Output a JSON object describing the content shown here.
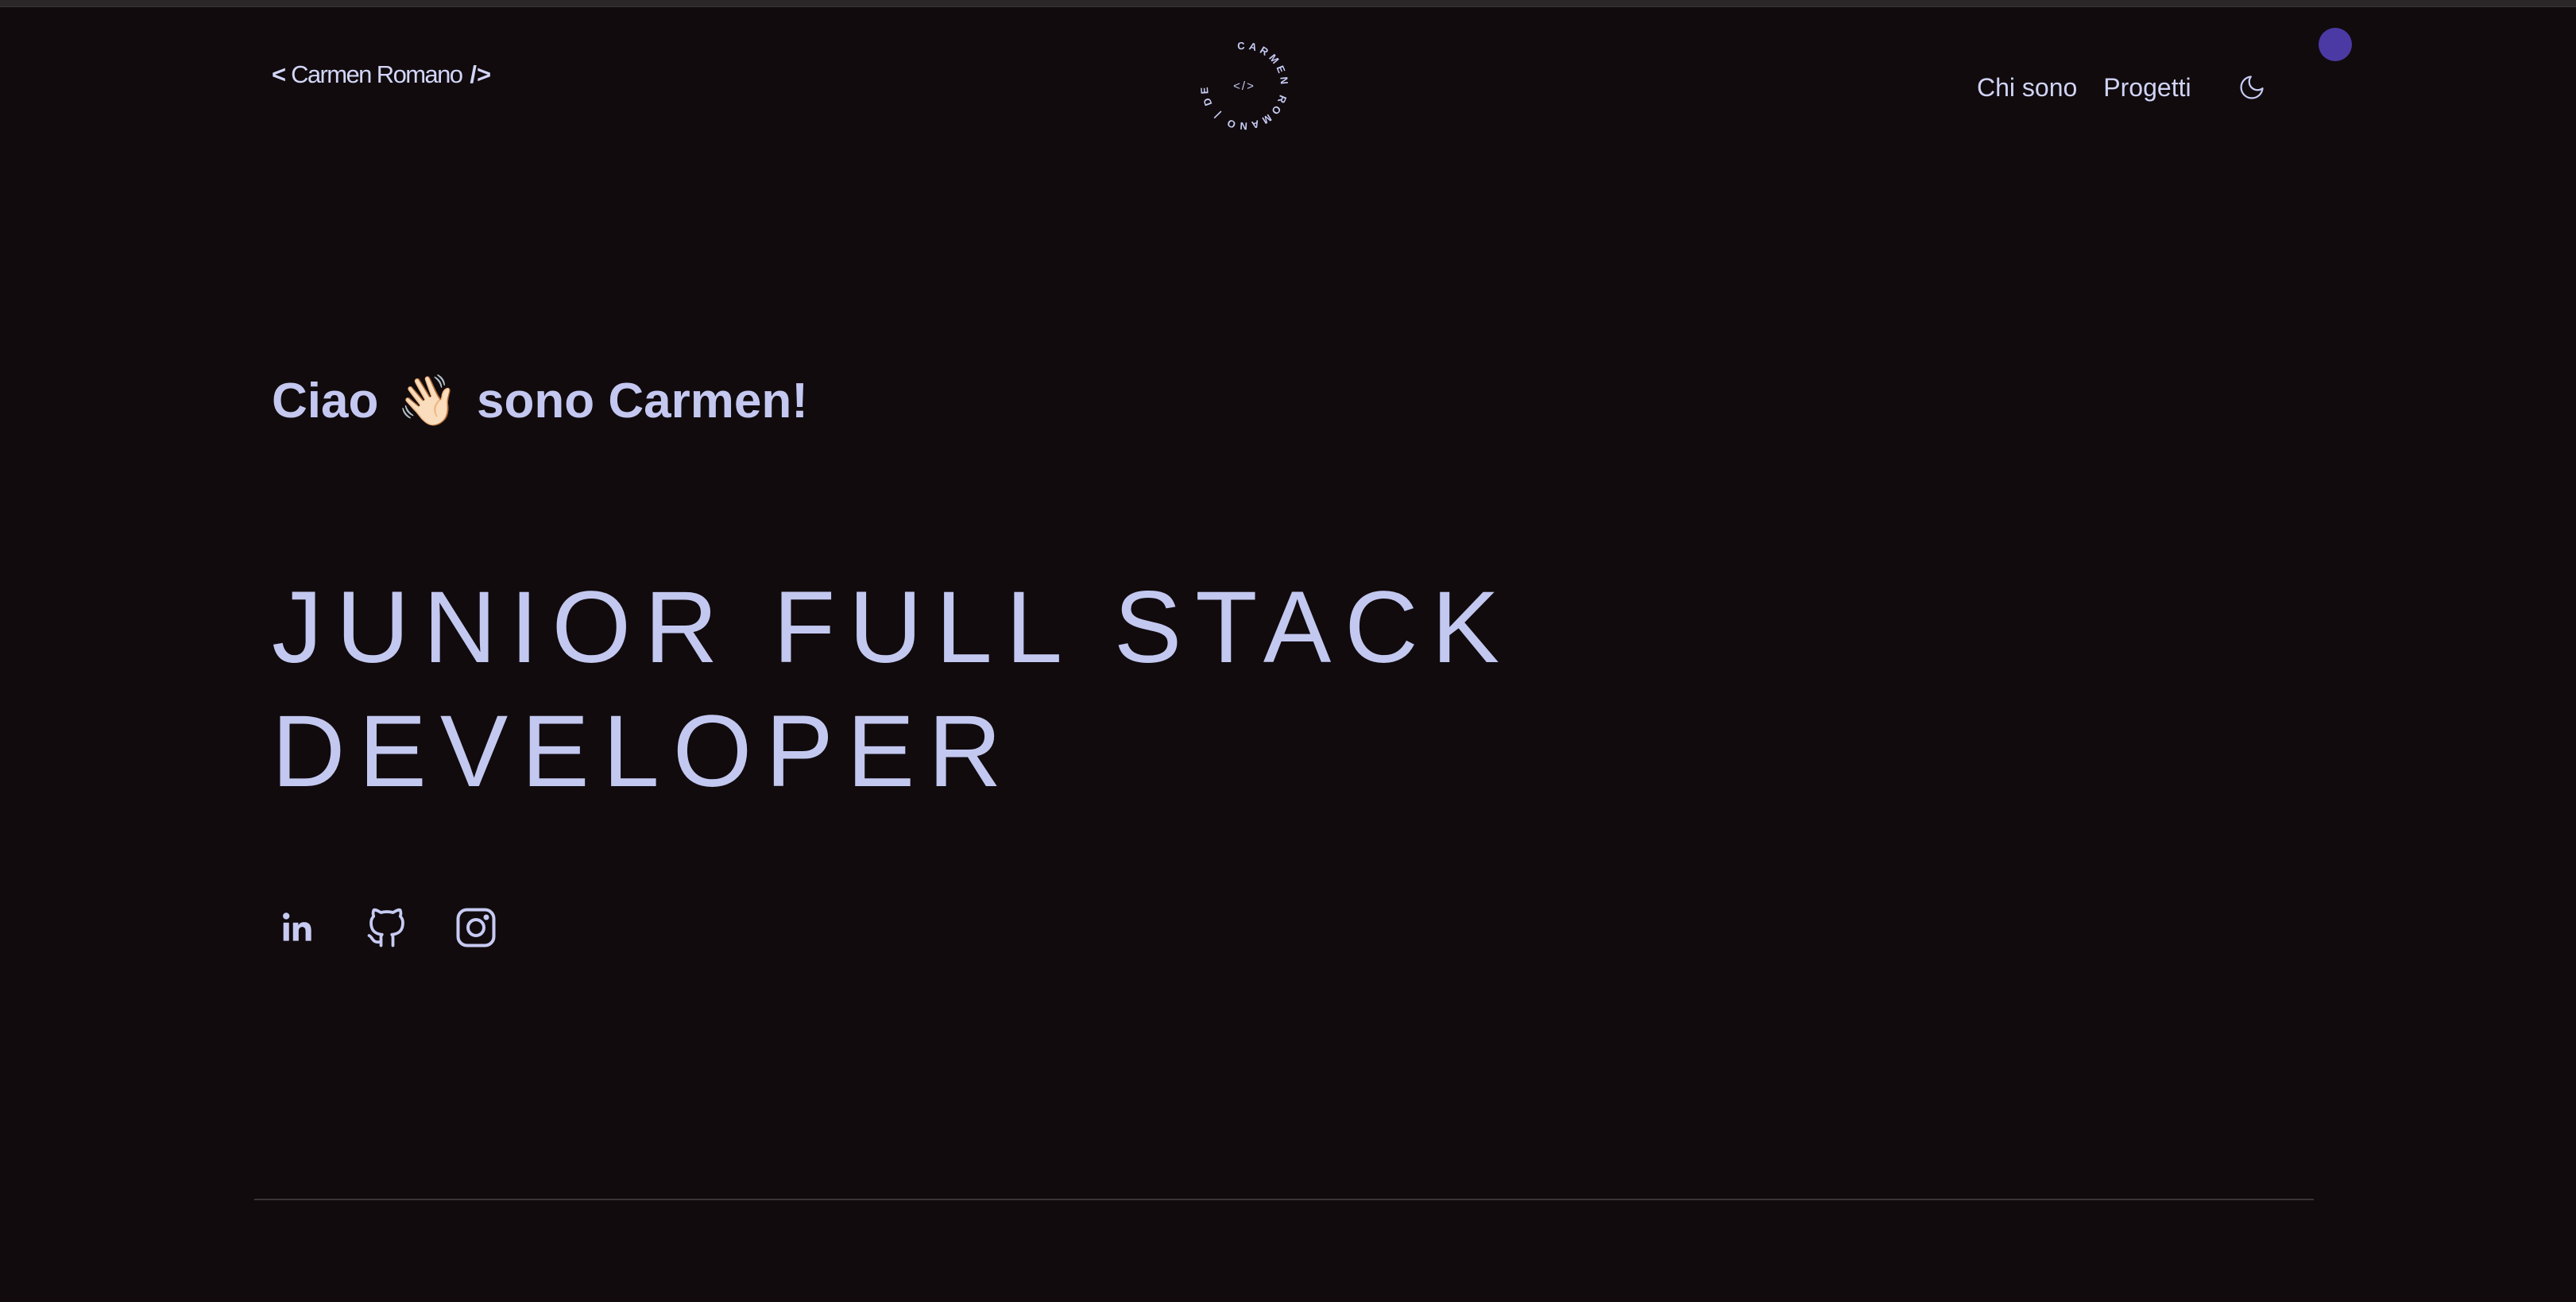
{
  "header": {
    "logo": {
      "open": "<",
      "name": "Carmen Romano",
      "close": "/>"
    },
    "badge": {
      "ring_text": "CARMEN ROMANO | DEVELOPER |",
      "center_text": "</>"
    },
    "nav": {
      "items": [
        {
          "label": "Chi sono"
        },
        {
          "label": "Progetti"
        }
      ],
      "theme_icon": "moon-icon"
    }
  },
  "hero": {
    "greeting_start": "Ciao",
    "greeting_emoji": "👋🏻",
    "greeting_end": "sono Carmen!",
    "title_line1": "JUNIOR FULL STACK",
    "title_line2": "DEVELOPER"
  },
  "socials": [
    {
      "icon": "linkedin-icon"
    },
    {
      "icon": "github-icon"
    },
    {
      "icon": "instagram-icon"
    }
  ],
  "colors": {
    "background": "#110b0e",
    "text": "#c3c8ee",
    "accent_dot": "#4b3aa4",
    "divider": "#3a3435"
  }
}
